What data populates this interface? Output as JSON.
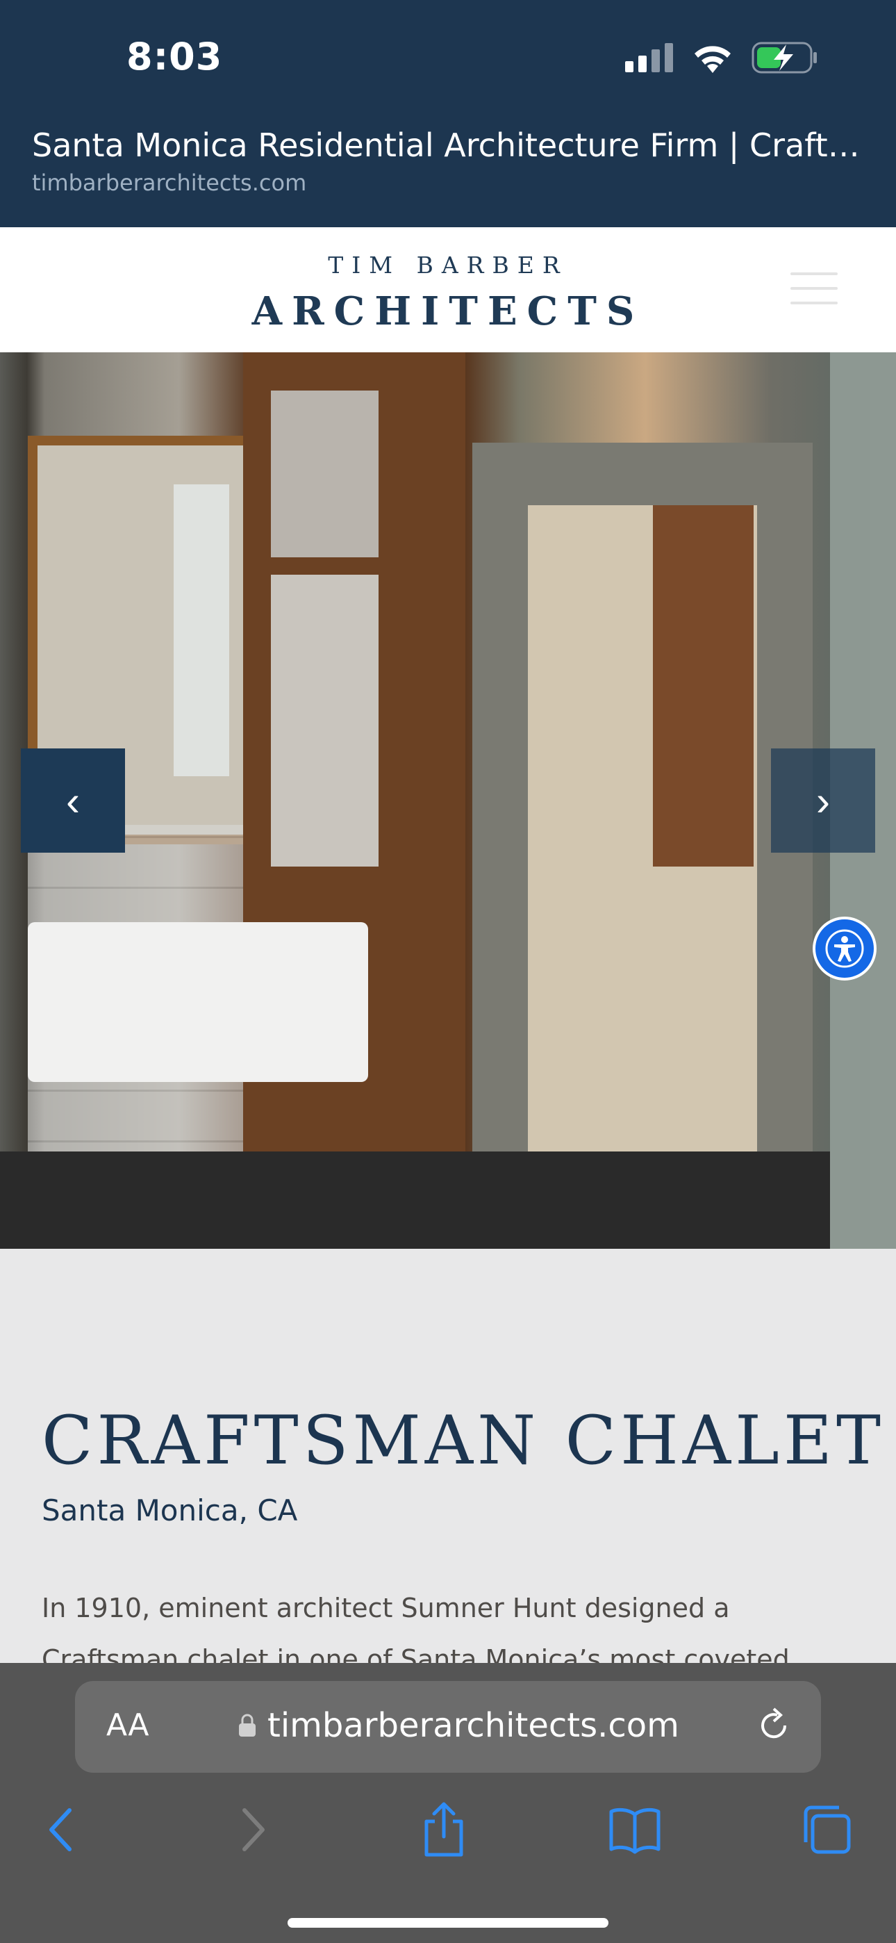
{
  "status_bar": {
    "time": "8:03"
  },
  "browser_top": {
    "page_title": "Santa Monica Residential Architecture Firm | Craftsm...",
    "domain": "timbarberarchitects.com"
  },
  "site_header": {
    "logo_top": "TIM BARBER",
    "logo_main": "ARCHITECTS"
  },
  "hero": {
    "prev_label": "‹",
    "next_label": "›"
  },
  "project": {
    "title": "CRAFTSMAN CHALET",
    "location": "Santa Monica, CA",
    "description": "In 1910, eminent architect Sumner Hunt designed a Craftsman chalet in one of Santa Monica’s most coveted"
  },
  "browser_bottom": {
    "text_size_label": "AA",
    "url": "timbarberarchitects.com"
  },
  "colors": {
    "brand_navy": "#1d3650",
    "accessibility_blue": "#1468e6",
    "safari_bar": "#555555",
    "ios_blue": "#2f8cf5"
  }
}
